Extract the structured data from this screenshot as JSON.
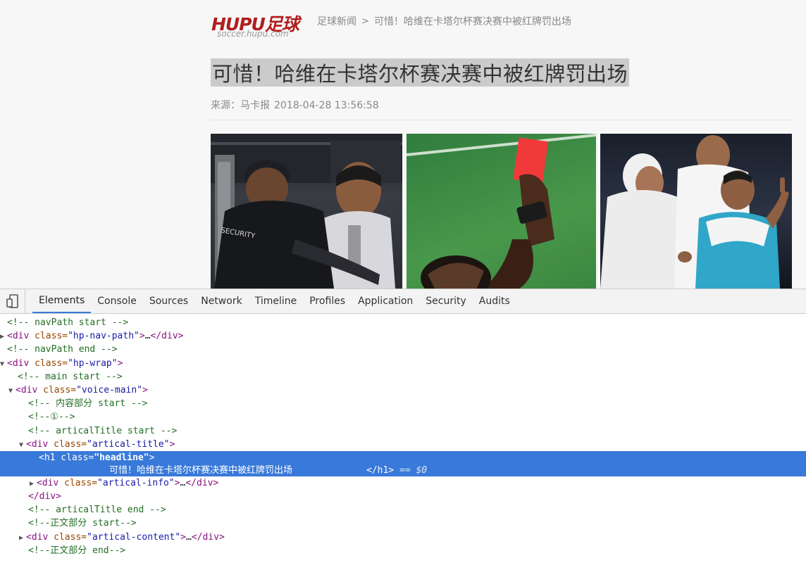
{
  "page": {
    "logo": {
      "main": "HUPU足球",
      "sub": "soccer.hupu.com"
    },
    "breadcrumb": {
      "section": "足球新闻",
      "separator": ">",
      "current": "可惜！哈维在卡塔尔杯赛决赛中被红牌罚出场"
    },
    "headline": "可惜！哈维在卡塔尔杯赛决赛中被红牌罚出场",
    "meta": {
      "source": "来源：马卡报",
      "date": "2018-04-28 13:56:58"
    },
    "photos": [
      {
        "alt": "security-guard-and-xavi"
      },
      {
        "alt": "referee-red-card"
      },
      {
        "alt": "xavi-protesting"
      }
    ]
  },
  "devtools": {
    "tabs": [
      "Elements",
      "Console",
      "Sources",
      "Network",
      "Timeline",
      "Profiles",
      "Application",
      "Security",
      "Audits"
    ],
    "active_tab": "Elements",
    "lines": [
      {
        "c1": "<!-- navPath start -->"
      },
      {
        "t1": "<div",
        "a1": " class=",
        "v1": "\"hp-nav-path\"",
        "t2": ">",
        "e": "…",
        "t3": "</div>"
      },
      {
        "c1": "<!-- navPath end -->"
      },
      {
        "t1": "<div",
        "a1": " class=",
        "v1": "\"hp-wrap\"",
        "t2": ">"
      },
      {
        "c1": "<!-- main start -->"
      },
      {
        "t1": "<div",
        "a1": " class=",
        "v1": "\"voice-main\"",
        "t2": ">"
      },
      {
        "c1": "<!-- 内容部分 start -->"
      },
      {
        "c1": "<!--①-->"
      },
      {
        "c1": "<!-- articalTitle start -->"
      },
      {
        "t1": "<div",
        "a1": " class=",
        "v1": "\"artical-title\"",
        "t2": ">"
      },
      {
        "t1": "<div",
        "a1": " class=",
        "v1": "\"artical-info\"",
        "t2": ">",
        "e": "…",
        "t3": "</div>"
      },
      {
        "t1": "</div>"
      },
      {
        "c1": "<!-- articalTitle end -->"
      },
      {
        "c1": "<!--正文部分 start-->"
      },
      {
        "t1": "<div",
        "a1": " class=",
        "v1": "\"artical-content\"",
        "t2": ">",
        "e": "…",
        "t3": "</div>"
      },
      {
        "c1": "<!--正文部分 end-->"
      }
    ],
    "selected": {
      "open_tag": "<h1",
      "attr": " class=",
      "value": "\"headline\"",
      "close": ">",
      "text": "可惜！哈维在卡塔尔杯赛决赛中被红牌罚出场",
      "end_tag": "</h1>",
      "equals": " == ",
      "var": "$0"
    }
  }
}
